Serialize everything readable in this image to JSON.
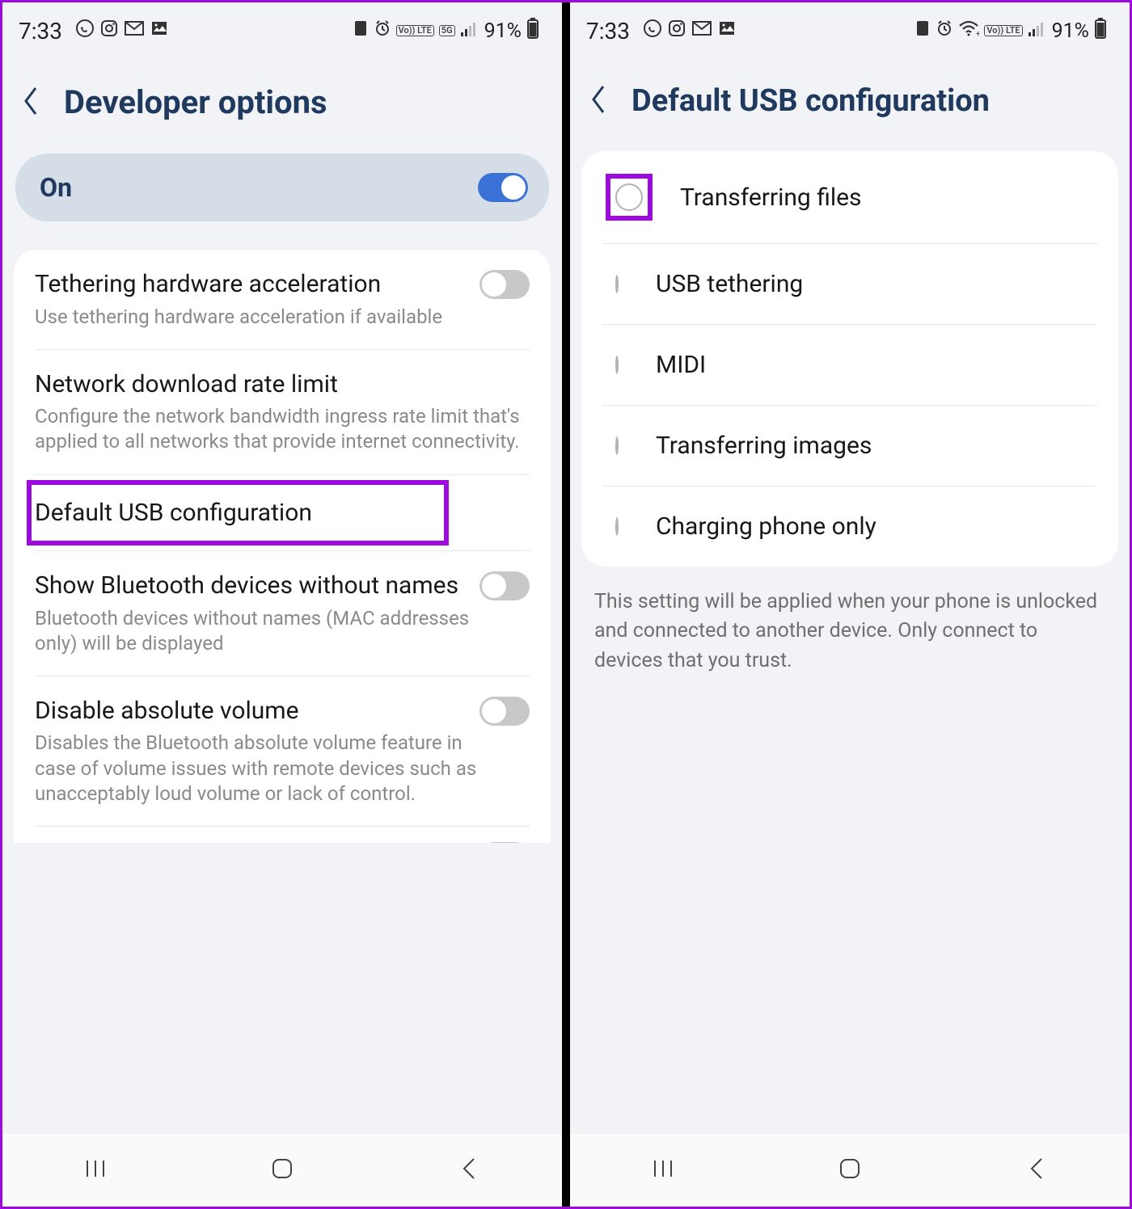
{
  "status": {
    "time": "7:33",
    "battery_percent": "91%",
    "volte": "Vo)) LTE",
    "fiveg": "5G"
  },
  "left": {
    "title": "Developer options",
    "on_label": "On",
    "rows": {
      "tethering_hw": {
        "title": "Tethering hardware acceleration",
        "desc": "Use tethering hardware acceleration if available"
      },
      "net_rate": {
        "title": "Network download rate limit",
        "desc": "Configure the network bandwidth ingress rate limit that's applied to all networks that provide internet connectivity."
      },
      "default_usb": {
        "title": "Default USB configuration"
      },
      "bt_no_names": {
        "title": "Show Bluetooth devices without names",
        "desc": "Bluetooth devices without names (MAC addresses only) will be displayed"
      },
      "abs_volume": {
        "title": "Disable absolute volume",
        "desc": "Disables the Bluetooth absolute volume feature in case of volume issues with remote devices such as unacceptably loud volume or lack of control."
      }
    }
  },
  "right": {
    "title": "Default USB configuration",
    "options": {
      "files": "Transferring files",
      "tether": "USB tethering",
      "midi": "MIDI",
      "images": "Transferring images",
      "charge": "Charging phone only"
    },
    "info": "This setting will be applied when your phone is unlocked and connected to another device. Only connect to devices that you trust."
  }
}
